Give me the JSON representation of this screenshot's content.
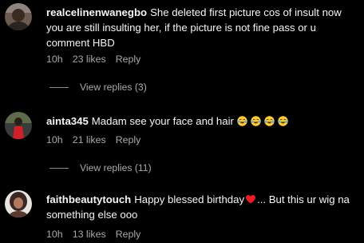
{
  "comments": [
    {
      "username": "realcelinenwanegbo",
      "text": "She deleted first picture cos of insult now you are still insulting her, if the picture is not fine pass or u comment HBD",
      "time": "10h",
      "likes": "23 likes",
      "reply": "Reply",
      "view_replies": "View replies (3)"
    },
    {
      "username": "ainta345",
      "text": "Madam see your face and hair",
      "emojis": [
        "face-with-tears-of-joy",
        "face-with-tears-of-joy",
        "face-with-tears-of-joy",
        "face-with-tears-of-joy"
      ],
      "time": "10h",
      "likes": "21 likes",
      "reply": "Reply",
      "view_replies": "View replies (11)"
    },
    {
      "username": "faithbeautytouch",
      "text_before": "Happy blessed birthday",
      "text_after": "... But this ur wig na something else ooo",
      "emoji": "red-heart",
      "time": "10h",
      "likes": "13 likes",
      "reply": "Reply"
    }
  ],
  "colors": {
    "background": "#000000",
    "text": "#f5f5f5",
    "secondary": "#a8a8a8",
    "heart": "#ed1c24",
    "emoji": "#ffcc33"
  }
}
